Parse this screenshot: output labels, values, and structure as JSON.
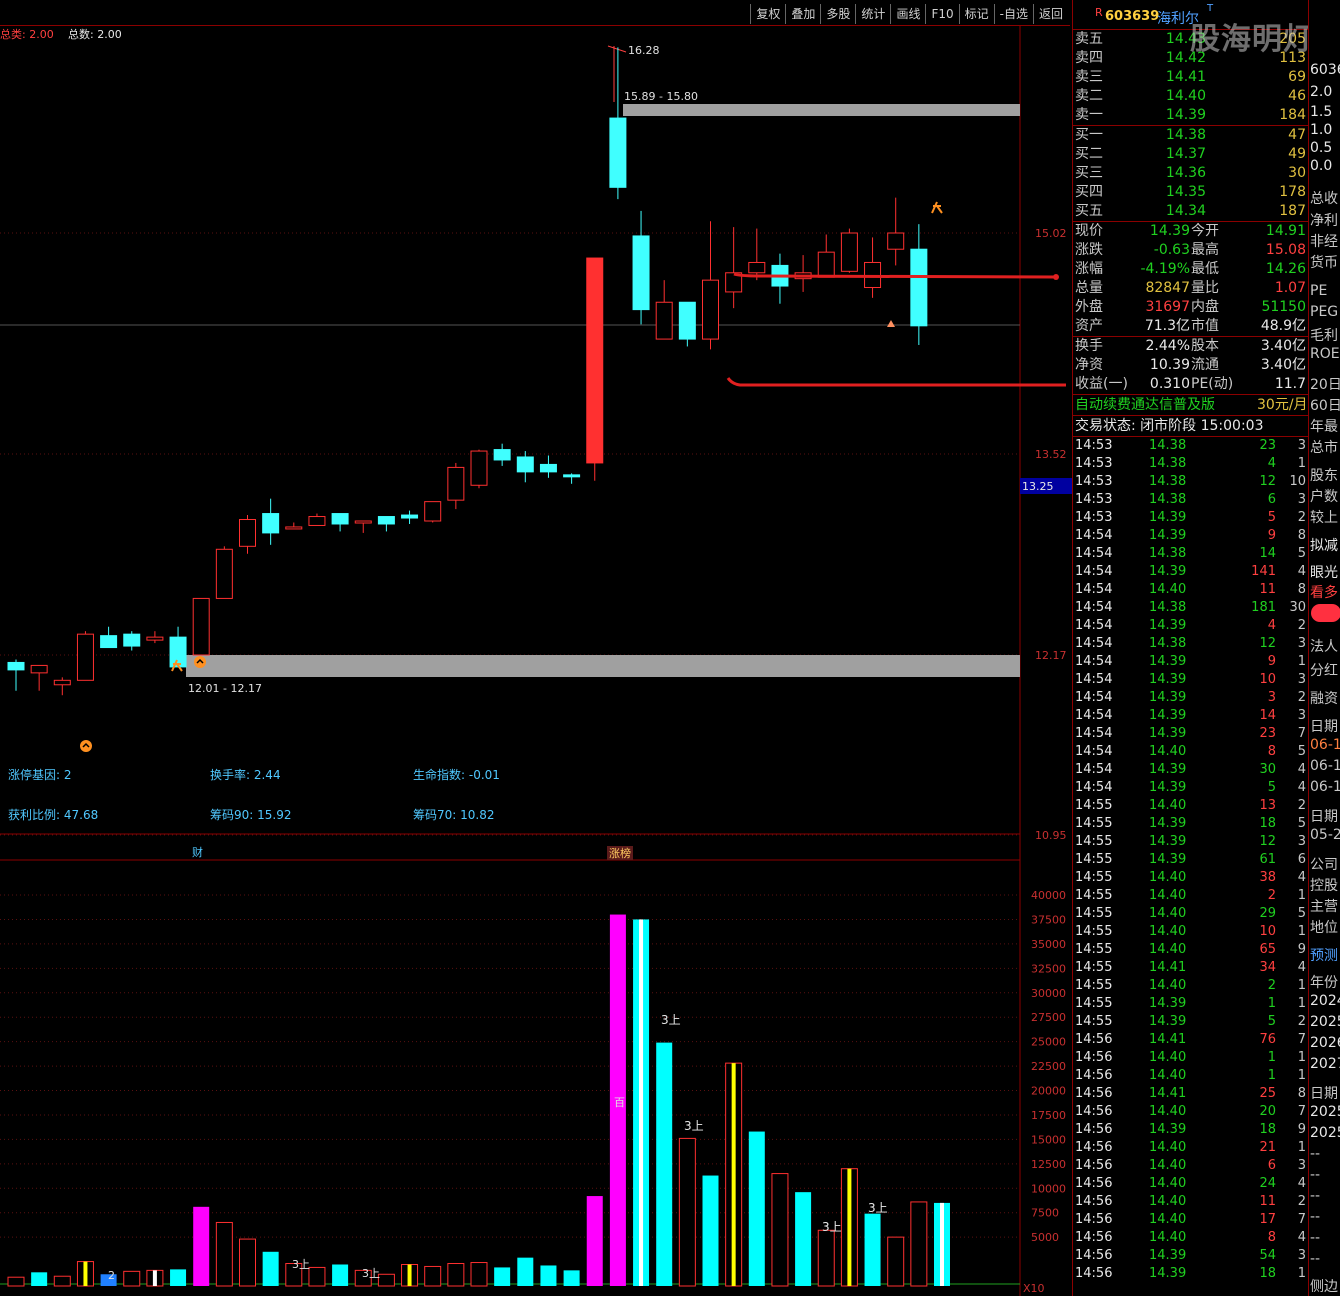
{
  "menu": [
    "复权",
    "叠加",
    "多股",
    "统计",
    "画线",
    "F10",
    "标记",
    "-自选",
    "返回"
  ],
  "legend": {
    "total_label": "总类: 2.00",
    "count_label": "总数: 2.00"
  },
  "price_axis": {
    "ticks": [
      "15.02",
      "13.52",
      "12.17",
      "10.95"
    ],
    "current_marker": "13.25"
  },
  "volume_axis": {
    "ticks": [
      "40000",
      "37500",
      "35000",
      "32500",
      "30000",
      "27500",
      "25000",
      "22500",
      "20000",
      "17500",
      "15000",
      "12500",
      "10000",
      "7500",
      "5000"
    ],
    "unit_label": "X10"
  },
  "annotations": {
    "high_label": "16.28",
    "upper_zone": "15.89 - 15.80",
    "lower_zone": "12.01 - 12.17",
    "finance_marker": "财",
    "limit_marker": "涨榜"
  },
  "indicators": {
    "row1": [
      "涨停基因: 2",
      "换手率: 2.44",
      "生命指数: -0.01"
    ],
    "row2": [
      "获利比例: 47.68",
      "筹码90: 15.92",
      "筹码70: 10.82"
    ]
  },
  "volume_labels": [
    "2",
    "3上",
    "3上",
    "百",
    "3上",
    "3上",
    "3上",
    "3上"
  ],
  "stock": {
    "badge": "R",
    "code": "603639",
    "name": "海利尔",
    "flag": "T"
  },
  "watermark": "股海明灯",
  "order_book": {
    "asks": [
      {
        "label": "卖五",
        "price": "14.43",
        "vol": "205"
      },
      {
        "label": "卖四",
        "price": "14.42",
        "vol": "113"
      },
      {
        "label": "卖三",
        "price": "14.41",
        "vol": "69"
      },
      {
        "label": "卖二",
        "price": "14.40",
        "vol": "46"
      },
      {
        "label": "卖一",
        "price": "14.39",
        "vol": "184"
      }
    ],
    "bids": [
      {
        "label": "买一",
        "price": "14.38",
        "vol": "47"
      },
      {
        "label": "买二",
        "price": "14.37",
        "vol": "49"
      },
      {
        "label": "买三",
        "price": "14.36",
        "vol": "30"
      },
      {
        "label": "买四",
        "price": "14.35",
        "vol": "178"
      },
      {
        "label": "买五",
        "price": "14.34",
        "vol": "187"
      }
    ]
  },
  "quote": [
    {
      "l1": "现价",
      "v1": "14.39",
      "l2": "今开",
      "v2": "14.91",
      "c1": "grn",
      "c2": "grn"
    },
    {
      "l1": "涨跌",
      "v1": "-0.63",
      "l2": "最高",
      "v2": "15.08",
      "c1": "grn",
      "c2": "red"
    },
    {
      "l1": "涨幅",
      "v1": "-4.19%",
      "l2": "最低",
      "v2": "14.26",
      "c1": "grn",
      "c2": "grn"
    },
    {
      "l1": "总量",
      "v1": "82847",
      "l2": "量比",
      "v2": "1.07",
      "c1": "yel",
      "c2": "red"
    },
    {
      "l1": "外盘",
      "v1": "31697",
      "l2": "内盘",
      "v2": "51150",
      "c1": "red",
      "c2": "grn"
    },
    {
      "l1": "资产",
      "v1": "71.3亿",
      "l2": "市值",
      "v2": "48.9亿",
      "c1": "wht",
      "c2": "wht"
    }
  ],
  "quote2": [
    {
      "l1": "换手",
      "v1": "2.44%",
      "l2": "股本",
      "v2": "3.40亿"
    },
    {
      "l1": "净资",
      "v1": "10.39",
      "l2": "流通",
      "v2": "3.40亿"
    },
    {
      "l1": "收益(一)",
      "v1": "0.310",
      "l2": "PE(动)",
      "v2": "11.7"
    }
  ],
  "promo": {
    "text": "自动续费通达信普及版",
    "price": "30元/月"
  },
  "trade_status": "交易状态: 闭市阶段 15:00:03",
  "trades": [
    [
      "14:53",
      "14.38",
      "23",
      "3",
      "g"
    ],
    [
      "14:53",
      "14.38",
      "4",
      "1",
      "g"
    ],
    [
      "14:53",
      "14.38",
      "12",
      "10",
      "g"
    ],
    [
      "14:53",
      "14.38",
      "6",
      "3",
      "g"
    ],
    [
      "14:53",
      "14.39",
      "5",
      "2",
      "r"
    ],
    [
      "14:54",
      "14.39",
      "9",
      "8",
      "r"
    ],
    [
      "14:54",
      "14.38",
      "14",
      "5",
      "g"
    ],
    [
      "14:54",
      "14.39",
      "141",
      "4",
      "r"
    ],
    [
      "14:54",
      "14.40",
      "11",
      "8",
      "r"
    ],
    [
      "14:54",
      "14.38",
      "181",
      "30",
      "g"
    ],
    [
      "14:54",
      "14.39",
      "4",
      "2",
      "r"
    ],
    [
      "14:54",
      "14.38",
      "12",
      "3",
      "g"
    ],
    [
      "14:54",
      "14.39",
      "9",
      "1",
      "r"
    ],
    [
      "14:54",
      "14.39",
      "10",
      "3",
      "r"
    ],
    [
      "14:54",
      "14.39",
      "3",
      "2",
      "r"
    ],
    [
      "14:54",
      "14.39",
      "14",
      "3",
      "r"
    ],
    [
      "14:54",
      "14.39",
      "23",
      "7",
      "r"
    ],
    [
      "14:54",
      "14.40",
      "8",
      "5",
      "r"
    ],
    [
      "14:54",
      "14.39",
      "30",
      "4",
      "g"
    ],
    [
      "14:54",
      "14.39",
      "5",
      "4",
      "g"
    ],
    [
      "14:55",
      "14.40",
      "13",
      "2",
      "r"
    ],
    [
      "14:55",
      "14.39",
      "18",
      "5",
      "g"
    ],
    [
      "14:55",
      "14.39",
      "12",
      "3",
      "g"
    ],
    [
      "14:55",
      "14.39",
      "61",
      "6",
      "g"
    ],
    [
      "14:55",
      "14.40",
      "38",
      "4",
      "r"
    ],
    [
      "14:55",
      "14.40",
      "2",
      "1",
      "r"
    ],
    [
      "14:55",
      "14.40",
      "29",
      "5",
      "g"
    ],
    [
      "14:55",
      "14.40",
      "10",
      "1",
      "r"
    ],
    [
      "14:55",
      "14.40",
      "65",
      "9",
      "r"
    ],
    [
      "14:55",
      "14.41",
      "34",
      "4",
      "r"
    ],
    [
      "14:55",
      "14.40",
      "2",
      "1",
      "g"
    ],
    [
      "14:55",
      "14.39",
      "1",
      "1",
      "g"
    ],
    [
      "14:55",
      "14.39",
      "5",
      "2",
      "g"
    ],
    [
      "14:56",
      "14.41",
      "76",
      "7",
      "r"
    ],
    [
      "14:56",
      "14.40",
      "1",
      "1",
      "g"
    ],
    [
      "14:56",
      "14.40",
      "1",
      "1",
      "g"
    ],
    [
      "14:56",
      "14.41",
      "25",
      "8",
      "r"
    ],
    [
      "14:56",
      "14.40",
      "20",
      "7",
      "g"
    ],
    [
      "14:56",
      "14.39",
      "18",
      "9",
      "g"
    ],
    [
      "14:56",
      "14.40",
      "21",
      "1",
      "r"
    ],
    [
      "14:56",
      "14.40",
      "6",
      "3",
      "r"
    ],
    [
      "14:56",
      "14.40",
      "24",
      "4",
      "g"
    ],
    [
      "14:56",
      "14.40",
      "11",
      "2",
      "r"
    ],
    [
      "14:56",
      "14.40",
      "17",
      "7",
      "r"
    ],
    [
      "14:56",
      "14.40",
      "8",
      "4",
      "r"
    ],
    [
      "14:56",
      "14.39",
      "54",
      "3",
      "g"
    ],
    [
      "14:56",
      "14.39",
      "18",
      "1",
      "g"
    ]
  ],
  "side_panel": [
    {
      "t": 62,
      "text": "6036",
      "c": "#e8e8e8"
    },
    {
      "t": 84,
      "text": "2.0",
      "c": "#e8e8e8"
    },
    {
      "t": 104,
      "text": "1.5",
      "c": "#e8e8e8"
    },
    {
      "t": 122,
      "text": "1.0",
      "c": "#e8e8e8"
    },
    {
      "t": 140,
      "text": "0.5",
      "c": "#e8e8e8"
    },
    {
      "t": 158,
      "text": "0.0",
      "c": "#e8e8e8"
    },
    {
      "t": 188,
      "text": "总收",
      "c": "#c8c8c8"
    },
    {
      "t": 210,
      "text": "净利",
      "c": "#c8c8c8"
    },
    {
      "t": 231,
      "text": "非经",
      "c": "#c8c8c8"
    },
    {
      "t": 252,
      "text": "货币",
      "c": "#c8c8c8"
    },
    {
      "t": 283,
      "text": "PE",
      "c": "#c8c8c8"
    },
    {
      "t": 304,
      "text": "PEG",
      "c": "#c8c8c8"
    },
    {
      "t": 325,
      "text": "毛利",
      "c": "#c8c8c8"
    },
    {
      "t": 346,
      "text": "ROE",
      "c": "#c8c8c8"
    },
    {
      "t": 374,
      "text": "20日",
      "c": "#c8c8c8"
    },
    {
      "t": 395,
      "text": "60日",
      "c": "#c8c8c8"
    },
    {
      "t": 416,
      "text": "年最",
      "c": "#c8c8c8"
    },
    {
      "t": 437,
      "text": "总市",
      "c": "#c8c8c8"
    },
    {
      "t": 465,
      "text": "股东",
      "c": "#c8c8c8"
    },
    {
      "t": 486,
      "text": "户数",
      "c": "#c8c8c8"
    },
    {
      "t": 507,
      "text": "较上",
      "c": "#c8c8c8"
    },
    {
      "t": 535,
      "text": "拟减",
      "c": "#e8e8e8"
    },
    {
      "t": 562,
      "text": "眼光",
      "c": "#e8e8e8"
    },
    {
      "t": 582,
      "text": "看多",
      "c": "#ff4040"
    },
    {
      "t": 636,
      "text": "法人",
      "c": "#c8c8c8"
    },
    {
      "t": 660,
      "text": "分红",
      "c": "#c8c8c8"
    },
    {
      "t": 688,
      "text": "融资",
      "c": "#c8c8c8"
    },
    {
      "t": 716,
      "text": "日期",
      "c": "#c8c8c8"
    },
    {
      "t": 737,
      "text": "06-1",
      "c": "#ff8040"
    },
    {
      "t": 758,
      "text": "06-1",
      "c": "#c8c8c8"
    },
    {
      "t": 779,
      "text": "06-1",
      "c": "#c8c8c8"
    },
    {
      "t": 806,
      "text": "日期",
      "c": "#c8c8c8"
    },
    {
      "t": 827,
      "text": "05-2",
      "c": "#c8c8c8"
    },
    {
      "t": 854,
      "text": "公司",
      "c": "#c8c8c8"
    },
    {
      "t": 875,
      "text": "控股",
      "c": "#c8c8c8"
    },
    {
      "t": 896,
      "text": "主营",
      "c": "#c8c8c8"
    },
    {
      "t": 917,
      "text": "地位",
      "c": "#c8c8c8"
    },
    {
      "t": 945,
      "text": "预测",
      "c": "#50a0ff"
    },
    {
      "t": 972,
      "text": "年份",
      "c": "#c8c8c8"
    },
    {
      "t": 993,
      "text": "2024",
      "c": "#e8e8e8"
    },
    {
      "t": 1014,
      "text": "2025",
      "c": "#e8e8e8"
    },
    {
      "t": 1035,
      "text": "2026",
      "c": "#e8e8e8"
    },
    {
      "t": 1056,
      "text": "2027",
      "c": "#e8e8e8"
    },
    {
      "t": 1083,
      "text": "日期",
      "c": "#c8c8c8"
    },
    {
      "t": 1104,
      "text": "2025",
      "c": "#e8e8e8"
    },
    {
      "t": 1125,
      "text": "2025",
      "c": "#e8e8e8"
    },
    {
      "t": 1146,
      "text": "--",
      "c": "#c8c8c8"
    },
    {
      "t": 1167,
      "text": "--",
      "c": "#c8c8c8"
    },
    {
      "t": 1188,
      "text": "--",
      "c": "#c8c8c8"
    },
    {
      "t": 1209,
      "text": "--",
      "c": "#c8c8c8"
    },
    {
      "t": 1230,
      "text": "--",
      "c": "#c8c8c8"
    },
    {
      "t": 1251,
      "text": "--",
      "c": "#c8c8c8"
    },
    {
      "t": 1276,
      "text": "侧边",
      "c": "#c8c8c8"
    }
  ],
  "candles": [
    {
      "o": 12.12,
      "h": 12.14,
      "l": 11.93,
      "c": 12.07
    },
    {
      "o": 12.05,
      "h": 12.1,
      "l": 11.93,
      "c": 12.1
    },
    {
      "o": 11.97,
      "h": 12.02,
      "l": 11.9,
      "c": 12.0
    },
    {
      "o": 12.0,
      "h": 12.33,
      "l": 12.0,
      "c": 12.31
    },
    {
      "o": 12.3,
      "h": 12.36,
      "l": 12.22,
      "c": 12.22
    },
    {
      "o": 12.31,
      "h": 12.33,
      "l": 12.2,
      "c": 12.23
    },
    {
      "o": 12.27,
      "h": 12.33,
      "l": 12.25,
      "c": 12.29
    },
    {
      "o": 12.29,
      "h": 12.36,
      "l": 12.25,
      "c": 12.09
    },
    {
      "o": 12.17,
      "h": 12.55,
      "l": 12.17,
      "c": 12.55
    },
    {
      "o": 12.55,
      "h": 12.9,
      "l": 12.55,
      "c": 12.88
    },
    {
      "o": 12.9,
      "h": 13.11,
      "l": 12.85,
      "c": 13.08
    },
    {
      "o": 13.12,
      "h": 13.22,
      "l": 12.91,
      "c": 12.99
    },
    {
      "o": 13.02,
      "h": 13.06,
      "l": 13.02,
      "c": 13.03
    },
    {
      "o": 13.04,
      "h": 13.12,
      "l": 13.04,
      "c": 13.1
    },
    {
      "o": 13.12,
      "h": 13.12,
      "l": 13.0,
      "c": 13.05
    },
    {
      "o": 13.07,
      "h": 13.07,
      "l": 12.99,
      "c": 13.07
    },
    {
      "o": 13.1,
      "h": 13.1,
      "l": 13.0,
      "c": 13.05
    },
    {
      "o": 13.11,
      "h": 13.14,
      "l": 13.05,
      "c": 13.09
    },
    {
      "o": 13.07,
      "h": 13.18,
      "l": 13.06,
      "c": 13.2
    },
    {
      "o": 13.21,
      "h": 13.46,
      "l": 13.15,
      "c": 13.43
    },
    {
      "o": 13.31,
      "h": 13.55,
      "l": 13.29,
      "c": 13.54
    },
    {
      "o": 13.55,
      "h": 13.59,
      "l": 13.44,
      "c": 13.48
    },
    {
      "o": 13.5,
      "h": 13.54,
      "l": 13.33,
      "c": 13.4
    },
    {
      "o": 13.45,
      "h": 13.51,
      "l": 13.36,
      "c": 13.4
    },
    {
      "o": 13.38,
      "h": 13.39,
      "l": 13.32,
      "c": 13.37
    },
    {
      "o": 13.46,
      "h": 14.85,
      "l": 13.34,
      "c": 14.85
    },
    {
      "o": 15.8,
      "h": 16.28,
      "l": 15.25,
      "c": 15.33
    },
    {
      "o": 15.0,
      "h": 15.17,
      "l": 14.4,
      "c": 14.5
    },
    {
      "o": 14.3,
      "h": 14.7,
      "l": 14.3,
      "c": 14.55
    },
    {
      "o": 14.55,
      "h": 14.55,
      "l": 14.25,
      "c": 14.3
    },
    {
      "o": 14.3,
      "h": 15.1,
      "l": 14.23,
      "c": 14.7
    },
    {
      "o": 14.62,
      "h": 15.06,
      "l": 14.51,
      "c": 14.75
    },
    {
      "o": 14.75,
      "h": 15.05,
      "l": 14.7,
      "c": 14.82
    },
    {
      "o": 14.8,
      "h": 14.88,
      "l": 14.54,
      "c": 14.66
    },
    {
      "o": 14.71,
      "h": 14.87,
      "l": 14.62,
      "c": 14.75
    },
    {
      "o": 14.72,
      "h": 15.01,
      "l": 14.72,
      "c": 14.89
    },
    {
      "o": 14.76,
      "h": 15.05,
      "l": 14.75,
      "c": 15.02
    },
    {
      "o": 14.65,
      "h": 14.99,
      "l": 14.58,
      "c": 14.82
    },
    {
      "o": 14.91,
      "h": 15.26,
      "l": 14.8,
      "c": 15.02
    },
    {
      "o": 14.91,
      "h": 15.08,
      "l": 14.26,
      "c": 14.39
    }
  ],
  "volumes": [
    {
      "v": 900,
      "c": "r"
    },
    {
      "v": 1400,
      "c": "c"
    },
    {
      "v": 1000,
      "c": "r"
    },
    {
      "v": 2500,
      "c": "y"
    },
    {
      "v": 1200,
      "c": "b"
    },
    {
      "v": 1500,
      "c": "r"
    },
    {
      "v": 1600,
      "c": "w"
    },
    {
      "v": 1700,
      "c": "c"
    },
    {
      "v": 8100,
      "c": "m"
    },
    {
      "v": 6500,
      "c": "r"
    },
    {
      "v": 4800,
      "c": "r"
    },
    {
      "v": 3500,
      "c": "c"
    },
    {
      "v": 2300,
      "c": "r"
    },
    {
      "v": 1900,
      "c": "r"
    },
    {
      "v": 2200,
      "c": "c"
    },
    {
      "v": 1600,
      "c": "r"
    },
    {
      "v": 1200,
      "c": "r"
    },
    {
      "v": 2200,
      "c": "y"
    },
    {
      "v": 2000,
      "c": "r"
    },
    {
      "v": 2300,
      "c": "r"
    },
    {
      "v": 2400,
      "c": "r"
    },
    {
      "v": 1900,
      "c": "c"
    },
    {
      "v": 2900,
      "c": "c"
    },
    {
      "v": 2100,
      "c": "c"
    },
    {
      "v": 1600,
      "c": "c"
    },
    {
      "v": 9200,
      "c": "m"
    },
    {
      "v": 38000,
      "c": "m"
    },
    {
      "v": 37500,
      "c": "cw"
    },
    {
      "v": 24900,
      "c": "c"
    },
    {
      "v": 15100,
      "c": "r"
    },
    {
      "v": 11300,
      "c": "c"
    },
    {
      "v": 22800,
      "c": "y"
    },
    {
      "v": 15800,
      "c": "c"
    },
    {
      "v": 11500,
      "c": "r"
    },
    {
      "v": 9600,
      "c": "c"
    },
    {
      "v": 5700,
      "c": "r"
    },
    {
      "v": 12000,
      "c": "y"
    },
    {
      "v": 7400,
      "c": "c"
    },
    {
      "v": 5000,
      "c": "r"
    },
    {
      "v": 8600,
      "c": "r"
    },
    {
      "v": 8500,
      "c": "cw"
    }
  ]
}
